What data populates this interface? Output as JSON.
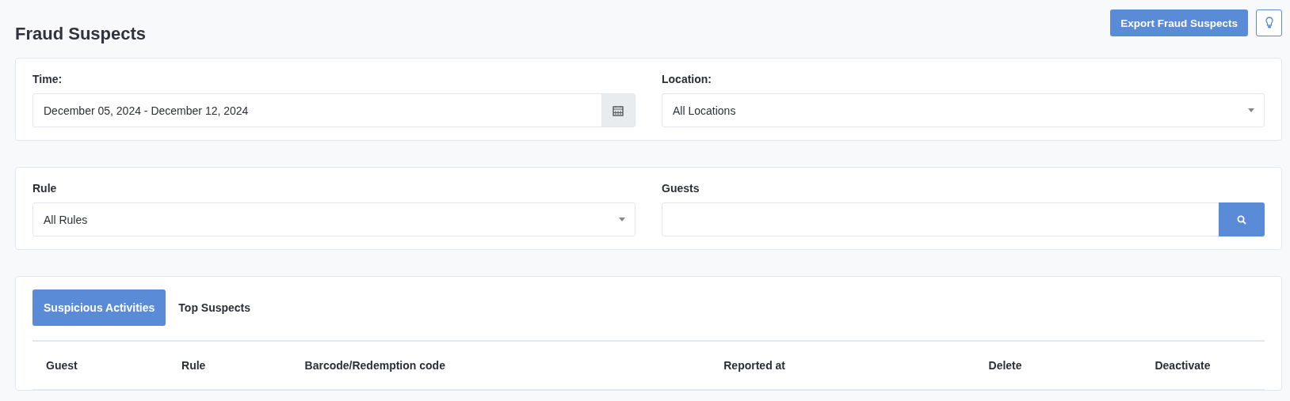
{
  "page_title": "Fraud Suspects",
  "header_buttons": [
    {
      "kind": "text",
      "label": "Export Fraud Suspects"
    },
    {
      "kind": "icon"
    }
  ],
  "filter_cards": [
    {
      "fields": [
        {
          "label": "Time:",
          "kind": "date",
          "value": "December 05, 2024 - December 12, 2024"
        },
        {
          "label": "Location:",
          "kind": "select",
          "value": "All Locations"
        }
      ]
    },
    {
      "fields": [
        {
          "label": "Rule",
          "kind": "select",
          "value": "All Rules"
        },
        {
          "label": "Guests",
          "kind": "search"
        }
      ]
    }
  ],
  "tabs": [
    {
      "label": "Suspicious Activities",
      "selected": true
    },
    {
      "label": "Top Suspects",
      "selected": false
    }
  ],
  "table": {
    "columns": [
      "Guest",
      "Rule",
      "Barcode/Redemption code",
      "Reported at",
      "Delete",
      "Deactivate"
    ]
  }
}
